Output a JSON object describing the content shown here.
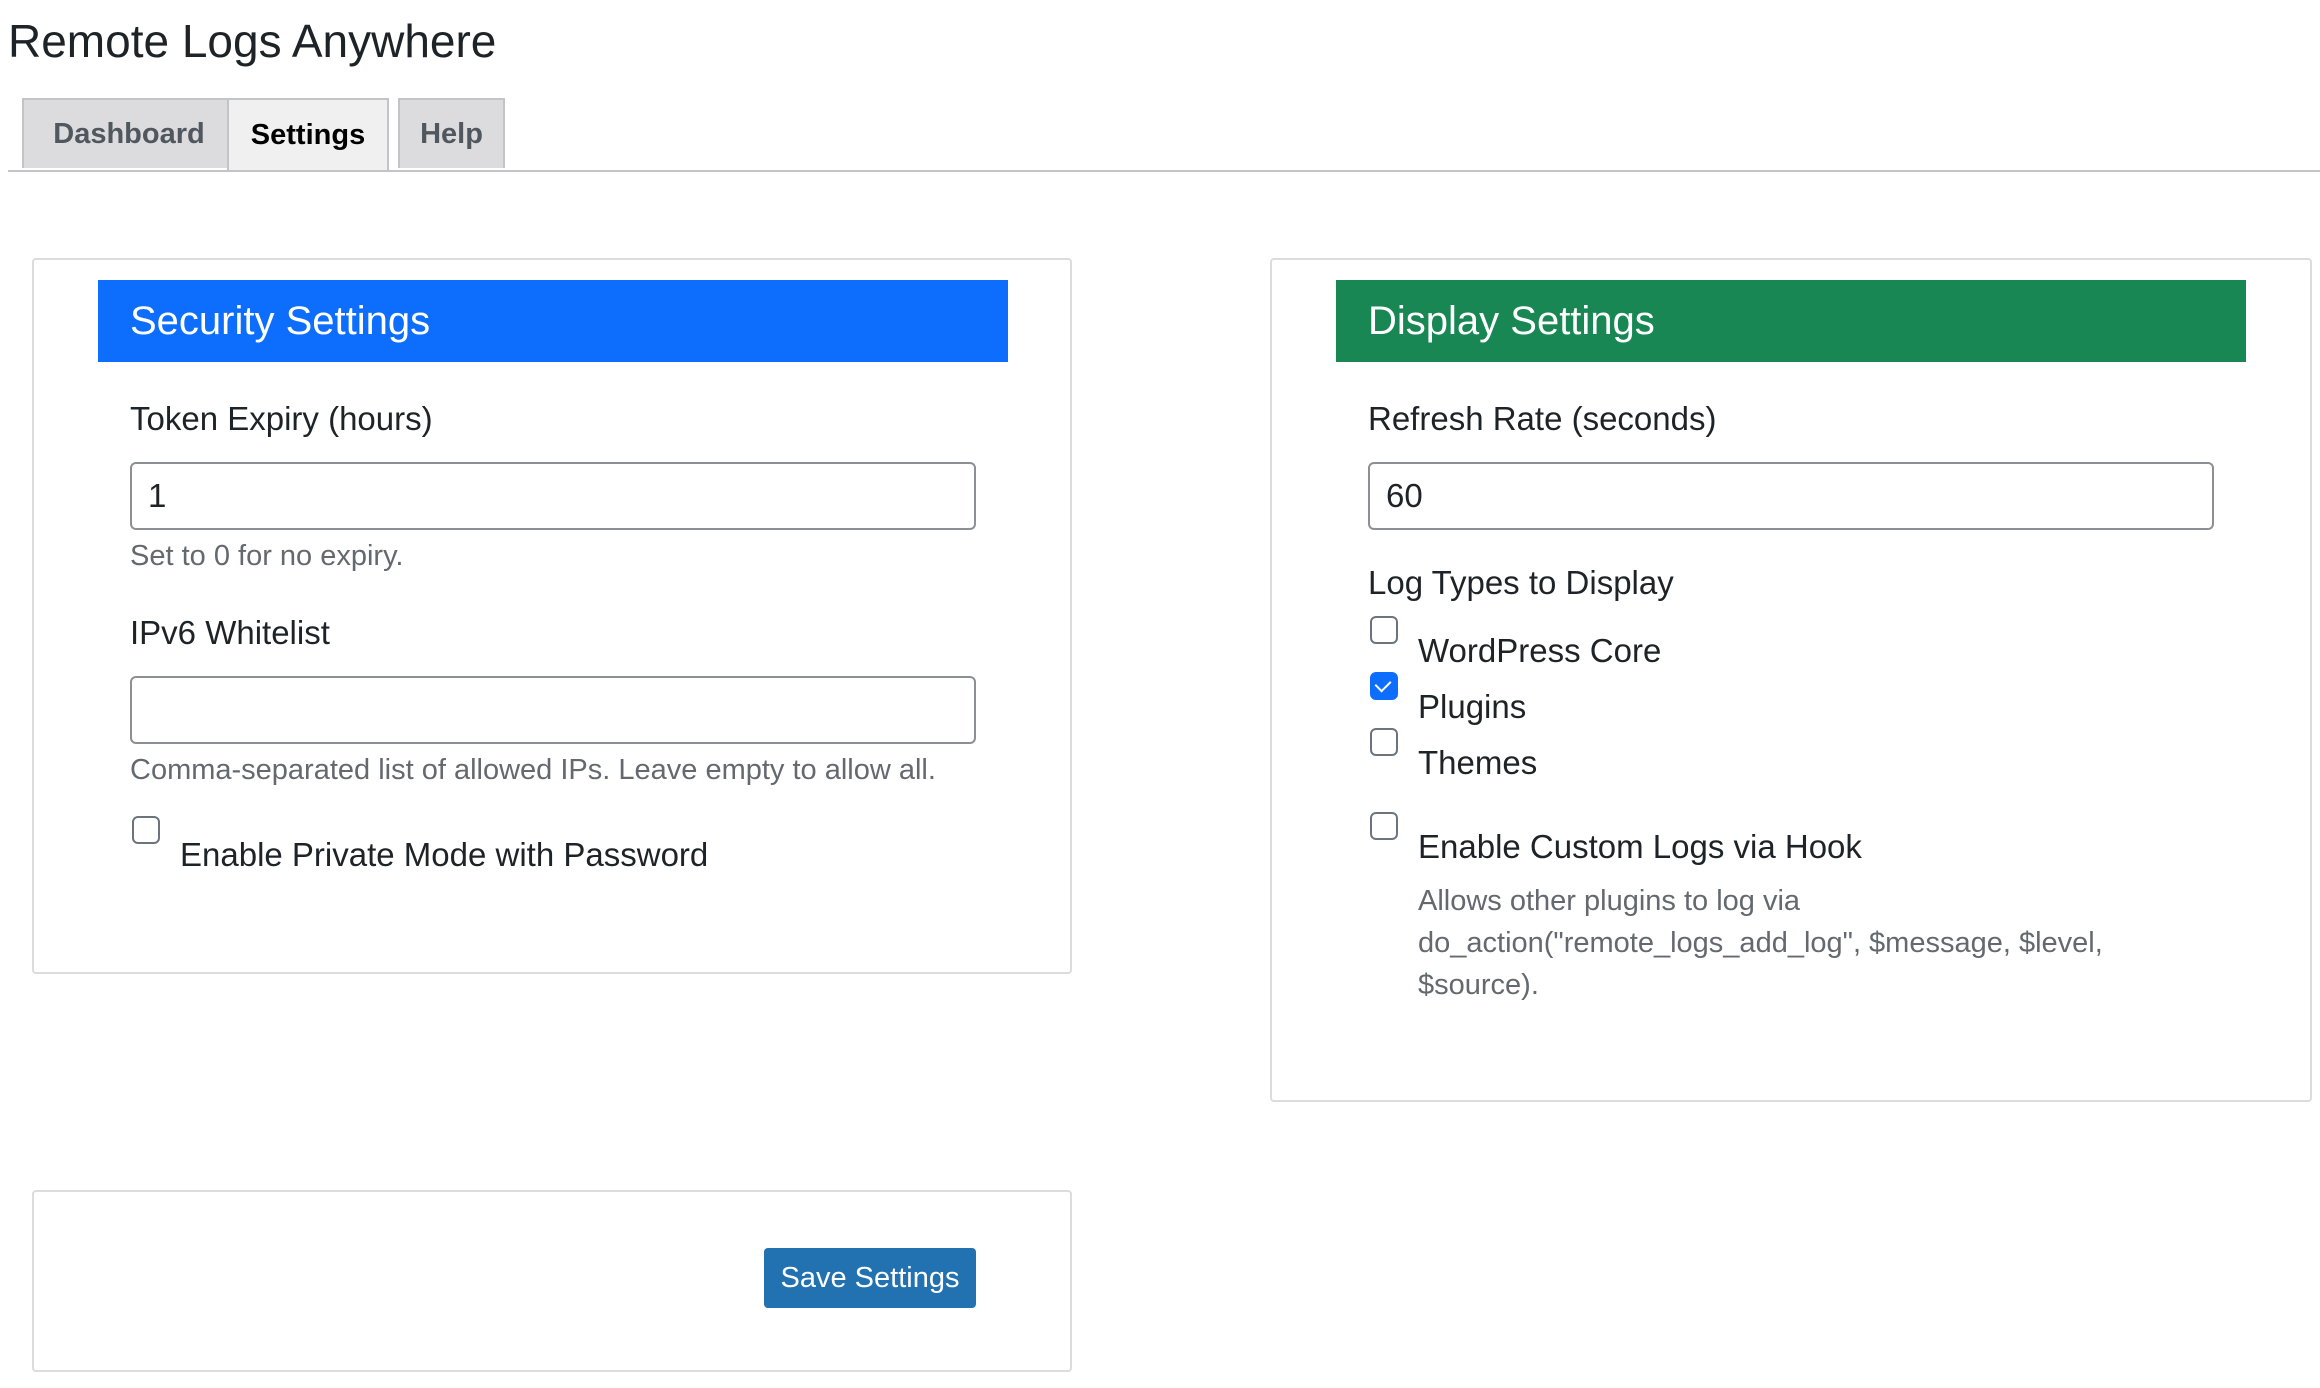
{
  "app": {
    "title": "Remote Logs Anywhere"
  },
  "tabs": [
    {
      "label": "Dashboard",
      "active": false
    },
    {
      "label": "Settings",
      "active": true
    },
    {
      "label": "Help",
      "active": false
    }
  ],
  "security": {
    "header": "Security Settings",
    "header_color": "#0d6efd",
    "token_expiry_label": "Token Expiry (hours)",
    "token_expiry_value": "1",
    "token_expiry_help": "Set to 0 for no expiry.",
    "ipv6_label": "IPv6 Whitelist",
    "ipv6_value": "",
    "ipv6_help": "Comma-separated list of allowed IPs. Leave empty to allow all.",
    "private_mode_label": "Enable Private Mode with Password",
    "private_mode_checked": false
  },
  "display": {
    "header": "Display Settings",
    "header_color": "#198754",
    "refresh_label": "Refresh Rate (seconds)",
    "refresh_value": "60",
    "log_types_label": "Log Types to Display",
    "log_types": [
      {
        "label": "WordPress Core",
        "checked": false
      },
      {
        "label": "Plugins",
        "checked": true
      },
      {
        "label": "Themes",
        "checked": false
      }
    ],
    "custom_logs_label": "Enable Custom Logs via Hook",
    "custom_logs_checked": false,
    "custom_logs_help_lines": [
      "Allows other plugins to log via",
      "do_action(\"remote_logs_add_log\", $message, $level,",
      "$source)."
    ]
  },
  "actions": {
    "save_label": "Save Settings",
    "save_color": "#2271b1"
  }
}
